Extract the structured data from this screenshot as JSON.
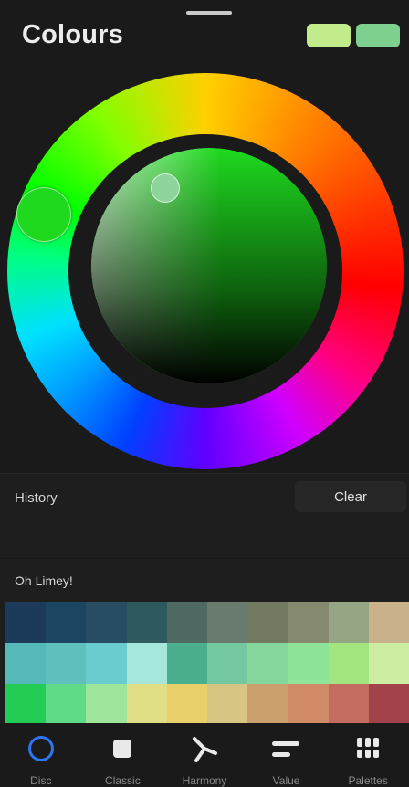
{
  "header": {
    "title": "Colours",
    "primary_color": "#c2ec8c",
    "secondary_color": "#7ed08f"
  },
  "wheel": {
    "hue_color": "#1fd91f",
    "accent_green": "#1fd91f"
  },
  "history": {
    "label": "History",
    "clear_label": "Clear"
  },
  "palette": {
    "name": "Oh Limey!",
    "rows": [
      [
        "#1c3a5a",
        "#1c4562",
        "#284c64",
        "#2f5a5d",
        "#4e6a63",
        "#697a6e",
        "#737a62",
        "#868a6e",
        "#96a584",
        "#c8b18b"
      ],
      [
        "#56b9b9",
        "#5fc0be",
        "#6bcccf",
        "#a6e6db",
        "#4bae8c",
        "#73c8a0",
        "#86d79d",
        "#8de397",
        "#a3e57f",
        "#cdeea2"
      ],
      [
        "#22cc55",
        "#5fdb87",
        "#9fe69c",
        "#e1df86",
        "#e8cf6a",
        "#d7c683",
        "#cca06d",
        "#d08a66",
        "#c46c60",
        "#a3424b"
      ]
    ]
  },
  "tabs": [
    {
      "id": "disc",
      "label": "Disc",
      "icon": "disc-icon",
      "active": true
    },
    {
      "id": "classic",
      "label": "Classic",
      "icon": "square-icon",
      "active": false
    },
    {
      "id": "harmony",
      "label": "Harmony",
      "icon": "harmony-icon",
      "active": false
    },
    {
      "id": "value",
      "label": "Value",
      "icon": "sliders-icon",
      "active": false
    },
    {
      "id": "palettes",
      "label": "Palettes",
      "icon": "grid-icon",
      "active": false
    }
  ]
}
